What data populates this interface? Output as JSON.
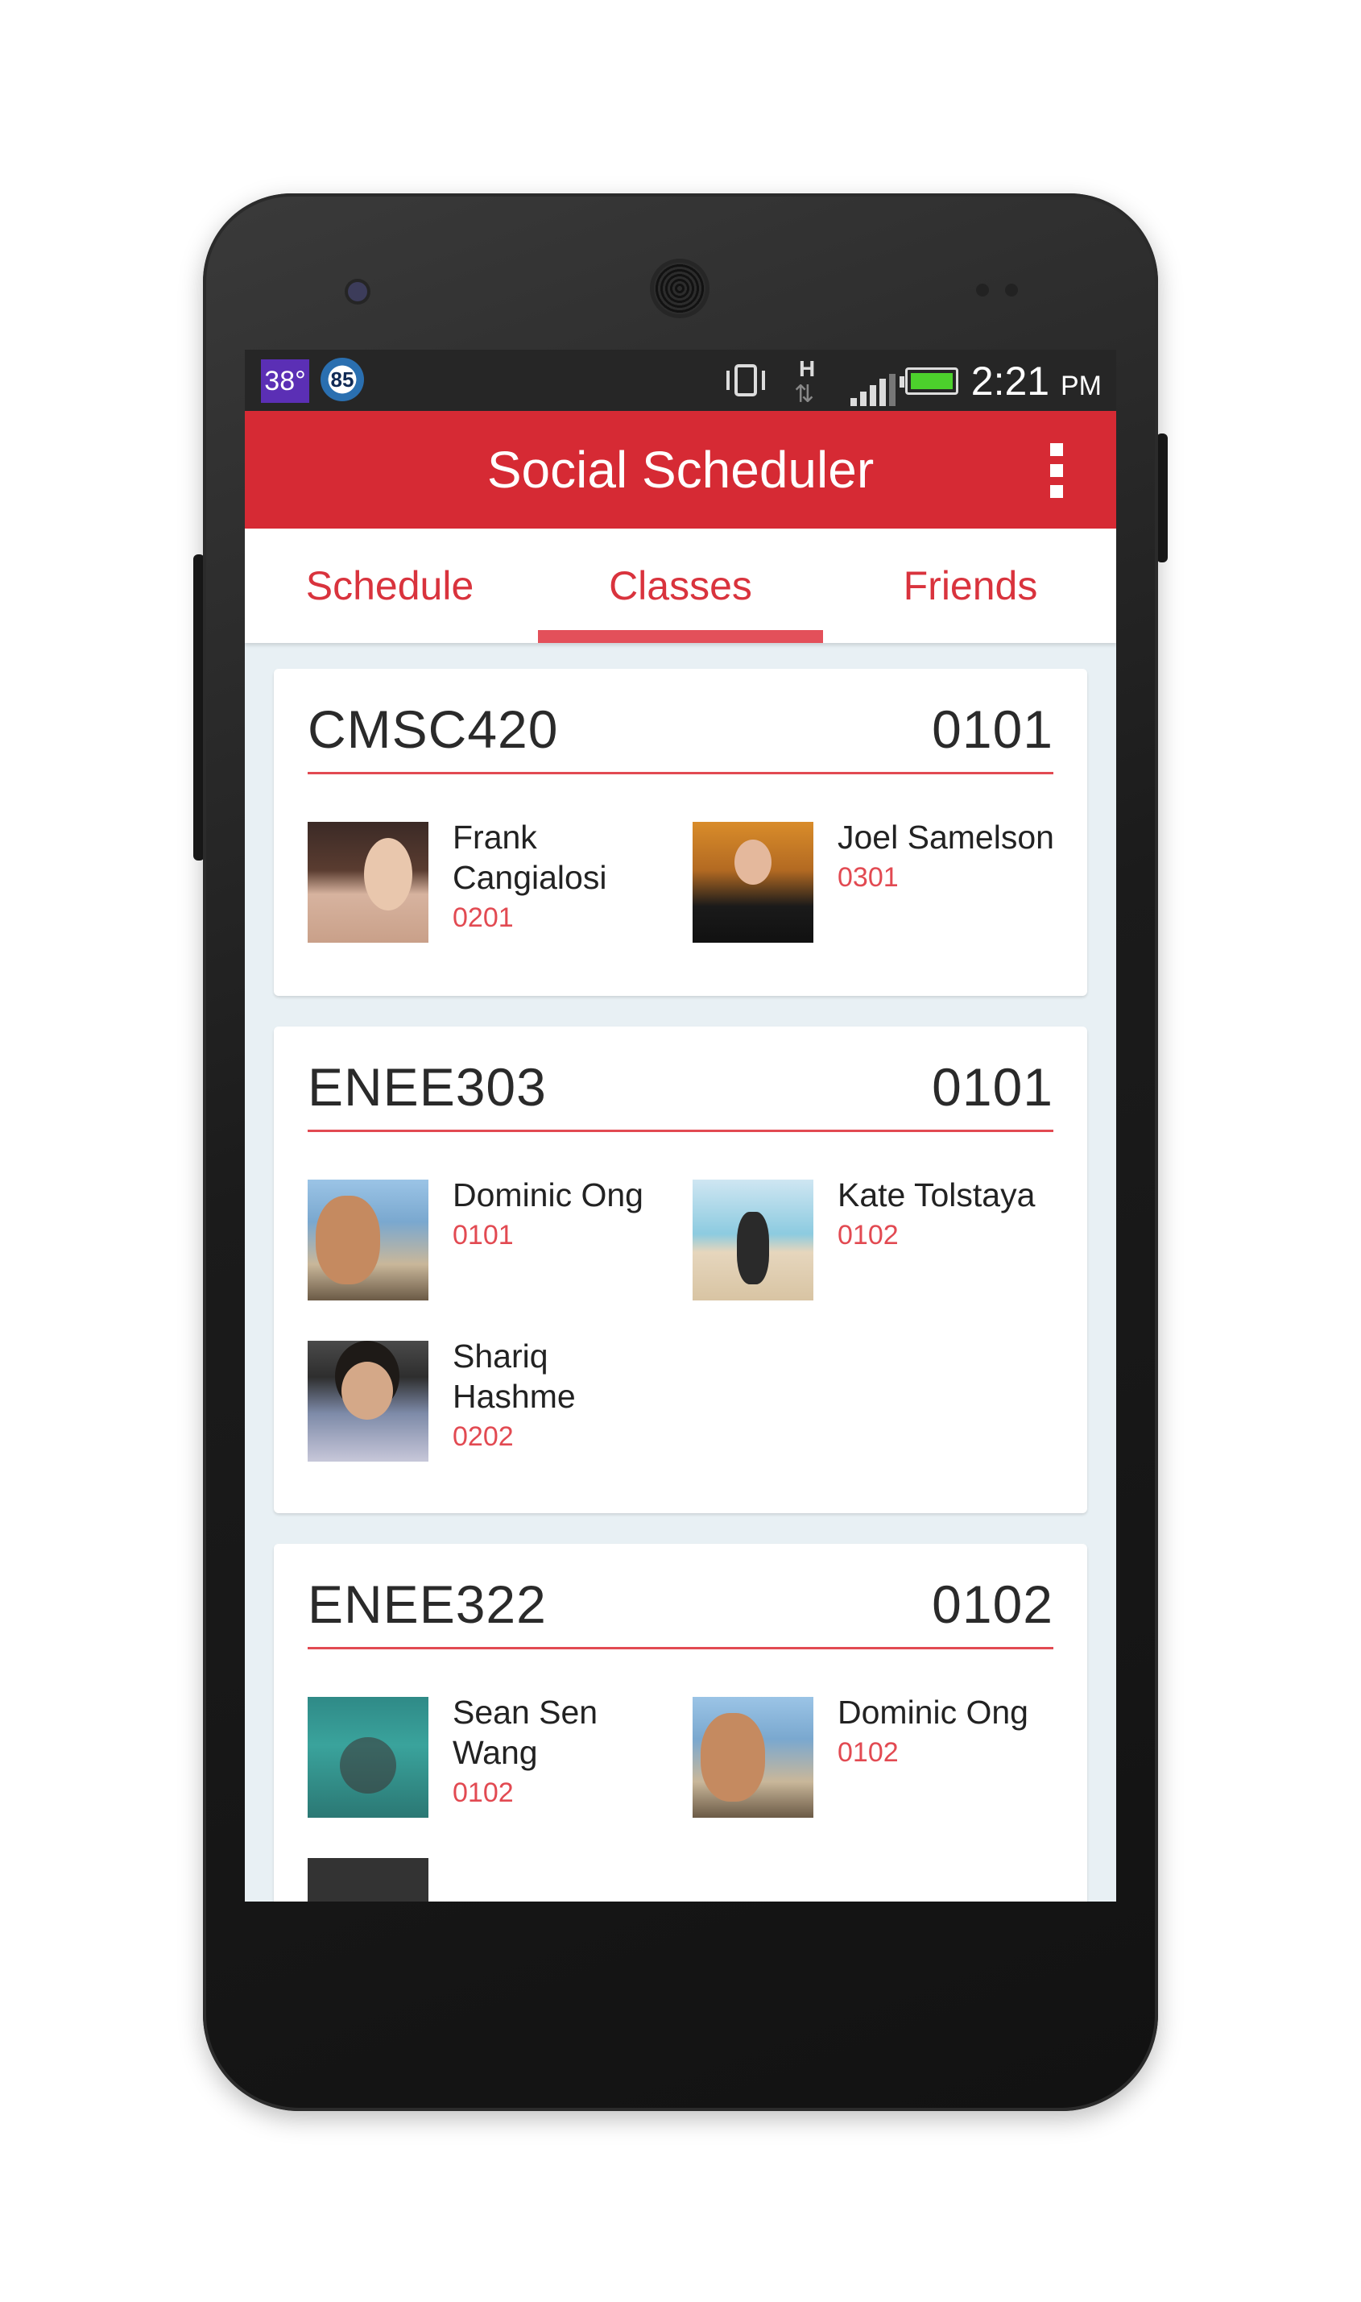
{
  "status_bar": {
    "temperature": "38°",
    "battery_badge": "85",
    "network_type": "H",
    "time": "2:21",
    "ampm": "PM",
    "icons": [
      "vibrate-icon",
      "data-transfer-icon",
      "signal-icon",
      "battery-icon"
    ]
  },
  "app_bar": {
    "title": "Social Scheduler",
    "menu_icon": "overflow-menu-icon"
  },
  "tabs": [
    {
      "label": "Schedule"
    },
    {
      "label": "Classes"
    },
    {
      "label": "Friends"
    }
  ],
  "active_tab": "Classes",
  "colors": {
    "accent": "#d62a34",
    "tab_text": "#d9333d",
    "section_text": "#e24a52",
    "background": "#e8f0f4"
  },
  "classes": [
    {
      "course": "CMSC420",
      "section": "0101",
      "friends": [
        {
          "name": "Frank Cangialosi",
          "section": "0201"
        },
        {
          "name": "Joel Samelson",
          "section": "0301"
        }
      ]
    },
    {
      "course": "ENEE303",
      "section": "0101",
      "friends": [
        {
          "name": "Dominic Ong",
          "section": "0101"
        },
        {
          "name": "Kate Tolstaya",
          "section": "0102"
        },
        {
          "name": "Shariq Hashme",
          "section": "0202"
        }
      ]
    },
    {
      "course": "ENEE322",
      "section": "0102",
      "friends": [
        {
          "name": "Sean Sen Wang",
          "section": "0102"
        },
        {
          "name": "Dominic Ong",
          "section": "0102"
        }
      ]
    }
  ]
}
